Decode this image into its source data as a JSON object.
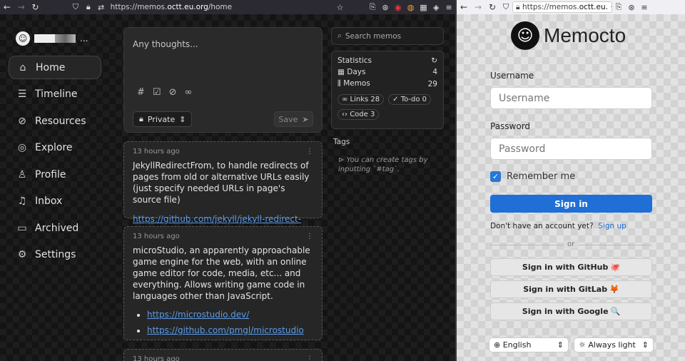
{
  "left_browser": {
    "url_prefix": "https://memos.",
    "url_domain": "octt.eu.org",
    "url_suffix": "/home"
  },
  "sidebar": {
    "user_more": "...",
    "items": [
      {
        "label": "Home",
        "icon": "home-icon",
        "glyph": "⌂",
        "active": true
      },
      {
        "label": "Timeline",
        "icon": "timeline-icon",
        "glyph": "☰"
      },
      {
        "label": "Resources",
        "icon": "paperclip-icon",
        "glyph": "⊘"
      },
      {
        "label": "Explore",
        "icon": "globe-icon",
        "glyph": "◎"
      },
      {
        "label": "Profile",
        "icon": "user-icon",
        "glyph": "♙"
      },
      {
        "label": "Inbox",
        "icon": "bell-icon",
        "glyph": "♫"
      },
      {
        "label": "Archived",
        "icon": "archive-icon",
        "glyph": "▭"
      },
      {
        "label": "Settings",
        "icon": "gear-icon",
        "glyph": "⚙"
      }
    ]
  },
  "editor": {
    "placeholder": "Any thoughts...",
    "visibility": "Private",
    "save": "Save"
  },
  "memos": [
    {
      "time": "13 hours ago",
      "text": "JekyllRedirectFrom, to handle redirects of pages from old or alternative URLs easily (just specify needed URLs in page's source file)",
      "link": "https://github.com/jekyll/jekyll-redirect-from"
    },
    {
      "time": "13 hours ago",
      "text": "microStudio, an apparently approachable game engine for the web, with an online game editor for code, media, etc... and everything. Allows writing game code in languages other than JavaScript.",
      "links": [
        "https://microstudio.dev/",
        "https://github.com/pmgl/microstudio"
      ]
    },
    {
      "time": "13 hours ago"
    }
  ],
  "search": {
    "placeholder": "Search memos"
  },
  "stats": {
    "title": "Statistics",
    "days_label": "Days",
    "days": "4",
    "memos_label": "Memos",
    "memos": "29",
    "links": "Links 28",
    "todo": "To-do 0",
    "code": "Code 3"
  },
  "tags": {
    "title": "Tags",
    "note": "You can create tags by inputting `#tag`."
  },
  "right_browser": {
    "url_prefix": "https://memos.",
    "url_domain": "octt.eu.",
    "more": "···"
  },
  "login": {
    "brand": "Memocto",
    "username_label": "Username",
    "username_placeholder": "Username",
    "password_label": "Password",
    "password_placeholder": "Password",
    "remember": "Remember me",
    "signin": "Sign in",
    "no_account": "Don't have an account yet?",
    "signup": "Sign up",
    "or": "or",
    "github": "Sign in with GitHub",
    "github_emoji": "🐙",
    "gitlab": "Sign in with GitLab",
    "gitlab_emoji": "🦊",
    "google": "Sign in with Google",
    "google_emoji": "🔍",
    "language": "English",
    "theme": "Always light"
  },
  "colors": {
    "accent": "#1f6fd6",
    "link": "#5b9be8"
  }
}
